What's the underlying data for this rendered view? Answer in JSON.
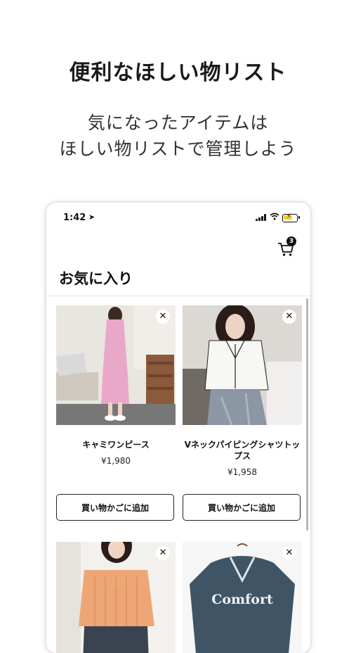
{
  "promo": {
    "headline": "便利なほしい物リスト",
    "sub_line1": "気になったアイテムは",
    "sub_line2": "ほしい物リストで管理しよう"
  },
  "status_bar": {
    "time": "1:42",
    "location_icon": "location-arrow-icon",
    "icons": [
      "signal-icon",
      "wifi-icon",
      "battery-charging-icon"
    ]
  },
  "header": {
    "cart_icon": "cart-icon",
    "cart_count": "3",
    "title": "お気に入り"
  },
  "products": [
    {
      "name": "キャミワンピース",
      "price": "¥1,980",
      "add_label": "買い物かごに追加",
      "remove_icon": "close-icon"
    },
    {
      "name": "Vネックパイピングシャツトップス",
      "price": "¥1,958",
      "add_label": "買い物かごに追加",
      "remove_icon": "close-icon"
    },
    {
      "remove_icon": "close-icon"
    },
    {
      "print_text": "Comfort",
      "remove_icon": "close-icon"
    }
  ],
  "colors": {
    "accent": "#111111",
    "battery": "#f2cf2a"
  }
}
